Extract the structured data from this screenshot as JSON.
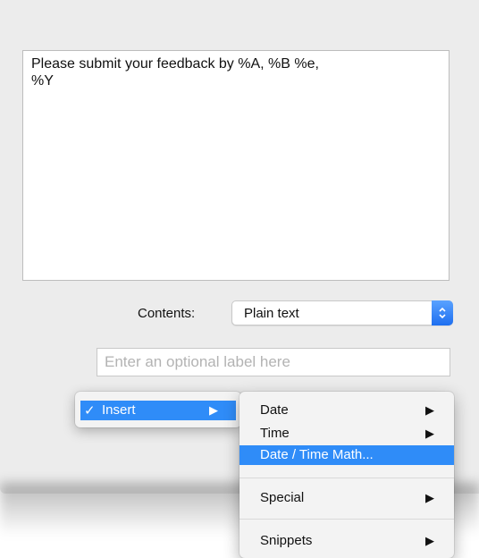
{
  "editor": {
    "text": "Please submit your feedback by %A, %B %e,\n%Y"
  },
  "contents": {
    "label": "Contents:",
    "value": "Plain text"
  },
  "label_field": {
    "placeholder": "Enter an optional label here"
  },
  "insert_menu": {
    "check": "✓",
    "label": "Insert",
    "arrow": "▶"
  },
  "submenu": {
    "items": [
      {
        "label": "Date",
        "arrow": "▶"
      },
      {
        "label": "Time",
        "arrow": "▶"
      },
      {
        "label": "Date / Time Math...",
        "arrow": ""
      },
      {
        "label": "Special",
        "arrow": "▶"
      },
      {
        "label": "Snippets",
        "arrow": "▶"
      }
    ]
  },
  "colors": {
    "accent": "#2f8cf8",
    "window_bg": "#ececec"
  }
}
